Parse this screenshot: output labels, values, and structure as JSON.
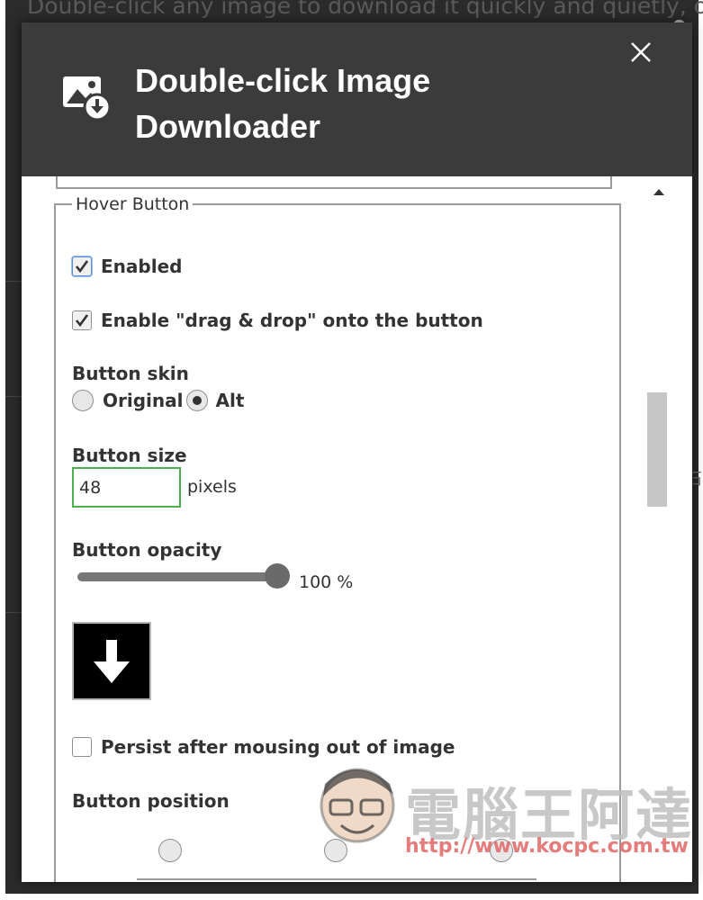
{
  "background": {
    "text": "Double-click any image to download it quickly and quietly, or",
    "right_char": "石"
  },
  "dialog": {
    "title": "Double-click Image Downloader",
    "close_icon": "close-icon",
    "app_icon": "image-download-icon"
  },
  "hover_button": {
    "legend": "Hover Button",
    "enabled_label": "Enabled",
    "enabled_checked": true,
    "drag_drop_label": "Enable \"drag & drop\" onto the button",
    "drag_drop_checked": true,
    "skin_heading": "Button skin",
    "skin_options": [
      "Original",
      "Alt"
    ],
    "skin_selected": "Alt",
    "size_heading": "Button size",
    "size_value": "48",
    "size_unit": "pixels",
    "opacity_heading": "Button opacity",
    "opacity_value": "100 %",
    "opacity_fraction": 1.0,
    "preview_icon": "arrow-down-icon",
    "persist_label": "Persist after mousing out of image",
    "persist_checked": false,
    "position_heading": "Button position"
  },
  "watermark": {
    "name": "電腦王阿達",
    "url": "http://www.kocpc.com.tw"
  },
  "colors": {
    "header_bg": "#3b3b3b",
    "input_border": "#4caf50",
    "accent_check": "#333333"
  }
}
